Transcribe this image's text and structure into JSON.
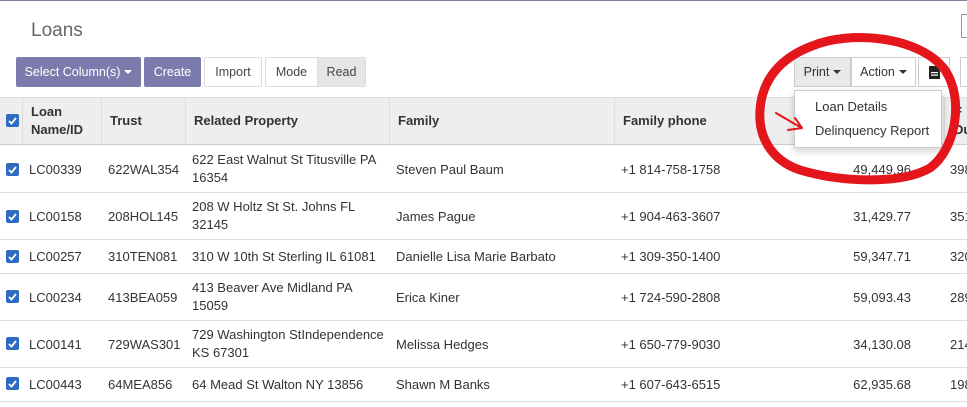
{
  "page": {
    "title": "Loans"
  },
  "toolbar": {
    "select_columns": "Select Column(s)",
    "create": "Create",
    "import": "Import",
    "mode": "Mode",
    "read": "Read",
    "print": "Print",
    "action": "Action"
  },
  "print_menu": {
    "items": [
      {
        "label": "Loan Details"
      },
      {
        "label": "Delinquency Report"
      }
    ]
  },
  "table": {
    "headers": {
      "loan_name": "Loan Name/ID",
      "trust": "Trust",
      "property": "Related Property",
      "family": "Family",
      "phone": "Family phone",
      "cut1": "F",
      "cut2": "Du"
    },
    "rows": [
      {
        "loan": "LC00339",
        "trust": "622WAL354",
        "property": "622 East Walnut St Titusville PA 16354",
        "family": "Steven Paul Baum",
        "phone": "+1 814-758-1758",
        "amount": "49,449.96",
        "cut": "398"
      },
      {
        "loan": "LC00158",
        "trust": "208HOL145",
        "property": "208 W Holtz St St. Johns FL 32145",
        "family": "James Pague",
        "phone": "+1 904-463-3607",
        "amount": "31,429.77",
        "cut": "351"
      },
      {
        "loan": "LC00257",
        "trust": "310TEN081",
        "property": "310 W 10th St Sterling IL 61081",
        "family": "Danielle Lisa Marie Barbato",
        "phone": "+1 309-350-1400",
        "amount": "59,347.71",
        "cut": "320"
      },
      {
        "loan": "LC00234",
        "trust": "413BEA059",
        "property": "413 Beaver Ave Midland PA 15059",
        "family": "Erica Kiner",
        "phone": "+1 724-590-2808",
        "amount": "59,093.43",
        "cut": "289"
      },
      {
        "loan": "LC00141",
        "trust": "729WAS301",
        "property": "729 Washington StIndependence KS 67301",
        "family": "Melissa Hedges",
        "phone": "+1 650-779-9030",
        "amount": "34,130.08",
        "cut": "214"
      },
      {
        "loan": "LC00443",
        "trust": "64MEA856",
        "property": "64 Mead St Walton NY 13856",
        "family": "Shawn M Banks",
        "phone": "+1 607-643-6515",
        "amount": "62,935.68",
        "cut": "198"
      }
    ]
  },
  "colors": {
    "primary": "#7c7bad",
    "checkbox": "#2d6cc0",
    "annotation": "#e4161c"
  }
}
